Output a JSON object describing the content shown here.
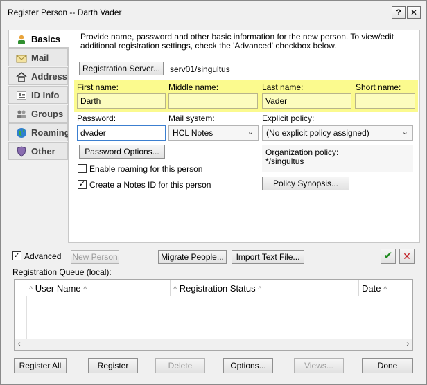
{
  "window": {
    "title": "Register Person -- Darth Vader",
    "help_glyph": "?",
    "close_glyph": "✕"
  },
  "tabs": [
    {
      "label": "Basics",
      "icon": "person-icon"
    },
    {
      "label": "Mail",
      "icon": "mail-icon"
    },
    {
      "label": "Address",
      "icon": "home-icon"
    },
    {
      "label": "ID Info",
      "icon": "id-card-icon"
    },
    {
      "label": "Groups",
      "icon": "group-icon"
    },
    {
      "label": "Roaming",
      "icon": "globe-icon"
    },
    {
      "label": "Other",
      "icon": "shield-icon"
    }
  ],
  "basics": {
    "intro": "Provide name, password and other basic information for the new person.  To view/edit additional registration settings, check the 'Advanced' checkbox below.",
    "registration_server_button": "Registration Server...",
    "registration_server_value": "serv01/singultus",
    "first_name_label": "First name:",
    "middle_name_label": "Middle name:",
    "last_name_label": "Last name:",
    "short_name_label": "Short name:",
    "first_name": "Darth",
    "middle_name": "",
    "last_name": "Vader",
    "short_name": "",
    "password_label": "Password:",
    "password_value": "dvader",
    "mail_system_label": "Mail system:",
    "mail_system_value": "HCL Notes",
    "explicit_policy_label": "Explicit policy:",
    "explicit_policy_value": "(No explicit policy assigned)",
    "password_options_button": "Password Options...",
    "org_policy_label": "Organization policy:",
    "org_policy_value": "*/singultus",
    "enable_roaming_label": "Enable roaming for this person",
    "enable_roaming_checked": false,
    "create_notes_id_label": "Create a Notes ID for this person",
    "create_notes_id_checked": true,
    "policy_synopsis_button": "Policy Synopsis..."
  },
  "actions": {
    "advanced_label": "Advanced",
    "advanced_checked": true,
    "new_person": "New Person",
    "migrate_people": "Migrate People...",
    "import_text_file": "Import Text File...",
    "accept_glyph": "✔",
    "reject_glyph": "✕"
  },
  "queue": {
    "label": "Registration Queue (local):",
    "columns": [
      "User Name",
      "Registration Status",
      "Date"
    ],
    "sort_glyph": "^",
    "rows": []
  },
  "footer": {
    "register_all": "Register All",
    "register": "Register",
    "delete": "Delete",
    "options": "Options...",
    "views": "Views...",
    "done": "Done"
  },
  "colors": {
    "name_highlight": "#fbfa8e",
    "accept": "#1d8a1d",
    "reject": "#c0161c"
  }
}
